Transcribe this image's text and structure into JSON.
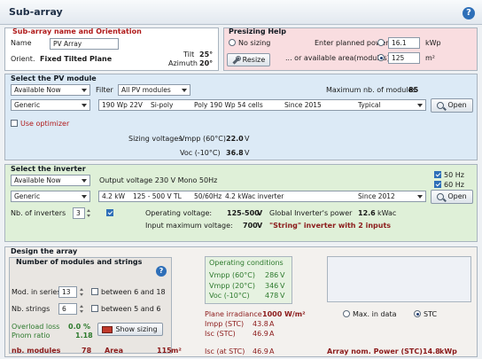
{
  "header": {
    "title": "Sub-array",
    "help": "?"
  },
  "orientation": {
    "title": "Sub-array name and Orientation",
    "name_label": "Name",
    "name_value": "PV Array",
    "orient_label": "Orient.",
    "orient_value": "Fixed Tilted Plane",
    "tilt_label": "Tilt",
    "tilt_value": "25°",
    "azimuth_label": "Azimuth",
    "azimuth_value": "20°"
  },
  "presizing": {
    "title": "Presizing Help",
    "no_sizing_label": "No sizing",
    "planned_power_label": "Enter planned power",
    "planned_power_value": "16.1",
    "planned_power_unit": "kWp",
    "area_label": "... or available area(modules)",
    "area_value": "125",
    "area_unit": "m²",
    "resize_label": "Resize"
  },
  "pv_module": {
    "title": "Select the PV module",
    "availability": "Available Now",
    "filter_label": "Filter",
    "filter_value": "All PV modules",
    "max_modules_label": "Maximum nb. of modules",
    "max_modules_value": "85",
    "manufacturer": "Generic",
    "model_power": "190 Wp 22V",
    "model_tech": "Si-poly",
    "model_desc": "Poly 190 Wp  54 cells",
    "model_since": "Since 2015",
    "model_type": "Typical",
    "open_label": "Open",
    "optimizer_label": "Use optimizer",
    "sizing_voltages_label": "Sizing voltages :",
    "vmpp_label": "Vmpp (60°C)",
    "vmpp_value": "22.0",
    "vmpp_unit": "V",
    "voc_label": "Voc (-10°C)",
    "voc_value": "36.8",
    "voc_unit": "V"
  },
  "inverter": {
    "title": "Select the inverter",
    "availability": "Available Now",
    "output_label": "Output voltage 230 V Mono 50Hz",
    "hz50_label": "50 Hz",
    "hz60_label": "60 Hz",
    "manufacturer": "Generic",
    "model_power": "4.2 kW",
    "model_range": "125 - 500 V",
    "model_tl": "TL",
    "model_freq": "50/60Hz",
    "model_desc": "4.2 kWac inverter",
    "model_since": "Since 2012",
    "open_label": "Open",
    "nb_label": "Nb. of inverters",
    "nb_value": "3",
    "op_voltage_label": "Operating voltage:",
    "op_voltage_value": "125-500",
    "op_voltage_unit": "V",
    "global_power_label": "Global Inverter's power",
    "global_power_value": "12.6",
    "global_power_unit": "kWac",
    "max_voltage_label": "Input maximum voltage:",
    "max_voltage_value": "700",
    "max_voltage_unit": "V",
    "string_note": "\"String\" inverter with 2 inputs"
  },
  "design": {
    "title": "Design the array",
    "nums_title": "Number of modules and strings",
    "series_label": "Mod. in series",
    "series_value": "13",
    "series_range": "between 6 and 18",
    "strings_label": "Nb. strings",
    "strings_value": "6",
    "strings_range": "between 5 and 6",
    "overload_label": "Overload loss",
    "overload_value": "0.0",
    "overload_unit": "%",
    "pnom_label": "Pnom ratio",
    "pnom_value": "1.18",
    "show_sizing_label": "Show sizing",
    "nb_modules_label": "nb. modules",
    "nb_modules_value": "78",
    "area_label": "Area",
    "area_value": "115",
    "area_unit": "m²"
  },
  "operating": {
    "title": "Operating conditions",
    "vmpp60_label": "Vmpp (60°C)",
    "vmpp60_value": "286",
    "vmpp20_label": "Vmpp (20°C)",
    "vmpp20_value": "346",
    "voc_label": "Voc (-10°C)",
    "voc_value": "478",
    "unit_v": "V",
    "irradiance_label": "Plane irradiance",
    "irradiance_value": "1000 W/m²",
    "max_in_data_label": "Max. in data",
    "stc_label": "STC",
    "impp_label": "Impp (STC)",
    "impp_value": "43.8",
    "isc_label": "Isc (STC)",
    "isc_value": "46.9",
    "unit_a": "A",
    "isc_at_label": "Isc (at STC)",
    "isc_at_value": "46.9",
    "array_power_label": "Array nom. Power (STC)",
    "array_power_value": "14.8",
    "array_power_unit": "kWp"
  }
}
